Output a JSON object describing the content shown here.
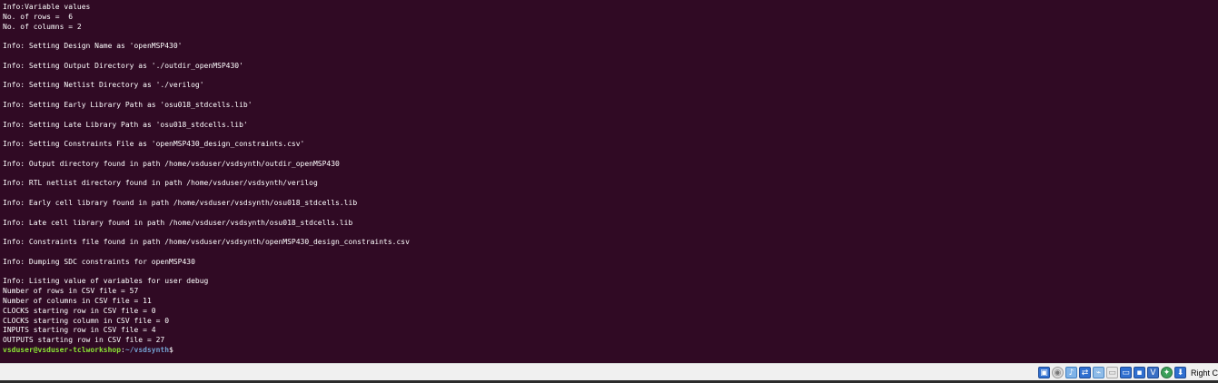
{
  "terminal": {
    "lines": [
      "Info:Variable values",
      "No. of rows =  6",
      "No. of columns = 2",
      "",
      "Info: Setting Design Name as 'openMSP430'",
      "",
      "Info: Setting Output Directory as './outdir_openMSP430'",
      "",
      "Info: Setting Netlist Directory as './verilog'",
      "",
      "Info: Setting Early Library Path as 'osu018_stdcells.lib'",
      "",
      "Info: Setting Late Library Path as 'osu018_stdcells.lib'",
      "",
      "Info: Setting Constraints File as 'openMSP430_design_constraints.csv'",
      "",
      "Info: Output directory found in path /home/vsduser/vsdsynth/outdir_openMSP430",
      "",
      "Info: RTL netlist directory found in path /home/vsduser/vsdsynth/verilog",
      "",
      "Info: Early cell library found in path /home/vsduser/vsdsynth/osu018_stdcells.lib",
      "",
      "Info: Late cell library found in path /home/vsduser/vsdsynth/osu018_stdcells.lib",
      "",
      "Info: Constraints file found in path /home/vsduser/vsdsynth/openMSP430_design_constraints.csv",
      "",
      "Info: Dumping SDC constraints for openMSP430",
      "",
      "Info: Listing value of variables for user debug",
      "Number of rows in CSV file = 57",
      "Number of columns in CSV file = 11",
      "CLOCKS starting row in CSV file = 0",
      "CLOCKS starting column in CSV file = 0",
      "INPUTS starting row in CSV file = 4",
      "OUTPUTS starting row in CSV file = 27"
    ],
    "prompt": {
      "user_host": "vsduser@vsduser-tclworkshop",
      "separator": ":",
      "path": "~/vsdsynth",
      "symbol": "$"
    }
  },
  "statusbar": {
    "icons": [
      "hard-disk-icon",
      "optical-drive-icon",
      "audio-icon",
      "network-icon",
      "usb-icon",
      "shared-folder-icon",
      "display-icon",
      "recording-icon",
      "vt-x-icon",
      "mouse-integration-icon",
      "keyboard-capture-icon"
    ],
    "host_key_label": "Right C"
  }
}
